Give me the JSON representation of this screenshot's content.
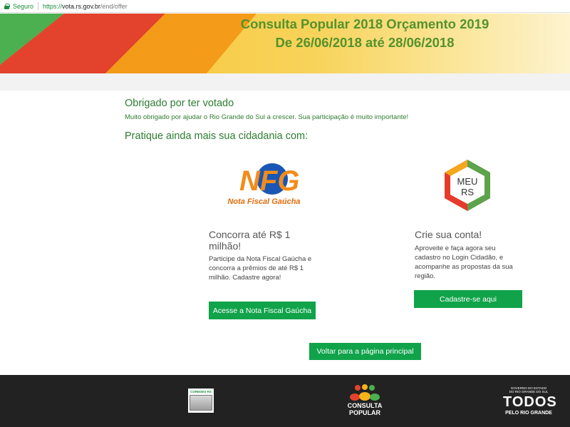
{
  "browser": {
    "secure_label": "Seguro",
    "url_protocol": "https://",
    "url_host": "vota.rs.gov.br",
    "url_path": "/end/offer"
  },
  "banner": {
    "title_line1": "Consulta Popular 2018 Orçamento 2019",
    "title_line2": "De 26/06/2018 até 28/06/2018",
    "colors": {
      "title": "#54922c",
      "green": "#4caf50",
      "red": "#e3432c",
      "orange": "#f49b1a",
      "yellow": "#f6c02c"
    }
  },
  "main": {
    "thanks_heading": "Obrigado por ter votado",
    "thanks_text": "Muito obrigado por ajudar o Rio Grande do Sul a crescer. Sua participação é muito importante!",
    "practice_heading": "Pratique ainda mais sua cidadania com:"
  },
  "nfg": {
    "logo_letters": "NFG",
    "logo_caption": "Nota Fiscal Gaúcha",
    "title": "Concorra até R$ 1 milhão!",
    "text": "Participe da Nota Fiscal Gaúcha e concorra a prêmios de até R$ 1 milhão. Cadastre agora!",
    "button": "Acesse a Nota Fiscal Gaúcha"
  },
  "meurs": {
    "logo_line1": "MEU",
    "logo_line2": "RS",
    "title": "Crie sua conta!",
    "text": "Aproveite e faça agora seu cadastro no Login Cidadão, e acompanhe as propostas da sua região.",
    "button": "Cadastre-se aqui"
  },
  "back_button": "Voltar para a página principal",
  "footer": {
    "coredes_label": "COREDES RS",
    "consulta_line1": "CONSULTA",
    "consulta_line2": "POPULAR",
    "todos_top1": "GOVERNO DO ESTADO",
    "todos_top2": "DO RIO GRANDE DO SUL",
    "todos_word": "TODOS",
    "todos_sub": "PELO RIO GRANDE"
  },
  "colors": {
    "accent_green": "#10a34a",
    "heading_green": "#2e7d32",
    "footer_bg": "#222222"
  }
}
